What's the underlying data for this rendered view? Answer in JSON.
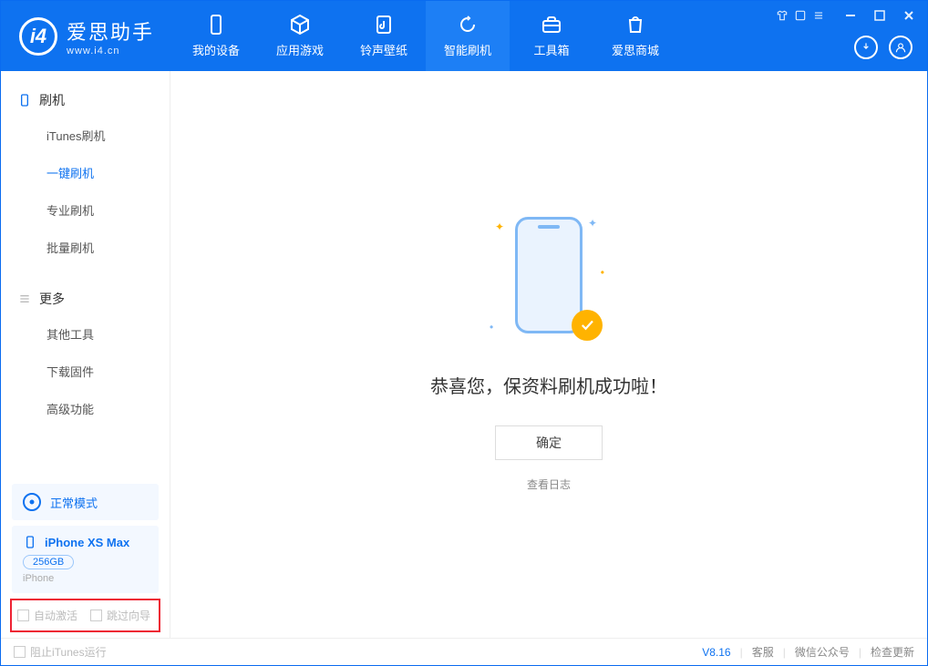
{
  "app": {
    "name_cn": "爱思助手",
    "name_en": "www.i4.cn",
    "logo_letter": "i4"
  },
  "nav": [
    {
      "label": "我的设备"
    },
    {
      "label": "应用游戏"
    },
    {
      "label": "铃声壁纸"
    },
    {
      "label": "智能刷机"
    },
    {
      "label": "工具箱"
    },
    {
      "label": "爱思商城"
    }
  ],
  "sidebar": {
    "flash": {
      "title": "刷机",
      "items": [
        {
          "label": "iTunes刷机"
        },
        {
          "label": "一键刷机"
        },
        {
          "label": "专业刷机"
        },
        {
          "label": "批量刷机"
        }
      ]
    },
    "more": {
      "title": "更多",
      "items": [
        {
          "label": "其他工具"
        },
        {
          "label": "下载固件"
        },
        {
          "label": "高级功能"
        }
      ]
    },
    "mode_label": "正常模式",
    "device": {
      "name": "iPhone XS Max",
      "capacity": "256GB",
      "type": "iPhone"
    },
    "checks": {
      "auto_activate": "自动激活",
      "skip_guide": "跳过向导"
    }
  },
  "main": {
    "message": "恭喜您，保资料刷机成功啦！",
    "ok": "确定",
    "view_log": "查看日志"
  },
  "footer": {
    "block_itunes": "阻止iTunes运行",
    "version": "V8.16",
    "links": {
      "service": "客服",
      "wechat": "微信公众号",
      "update": "检查更新"
    }
  }
}
